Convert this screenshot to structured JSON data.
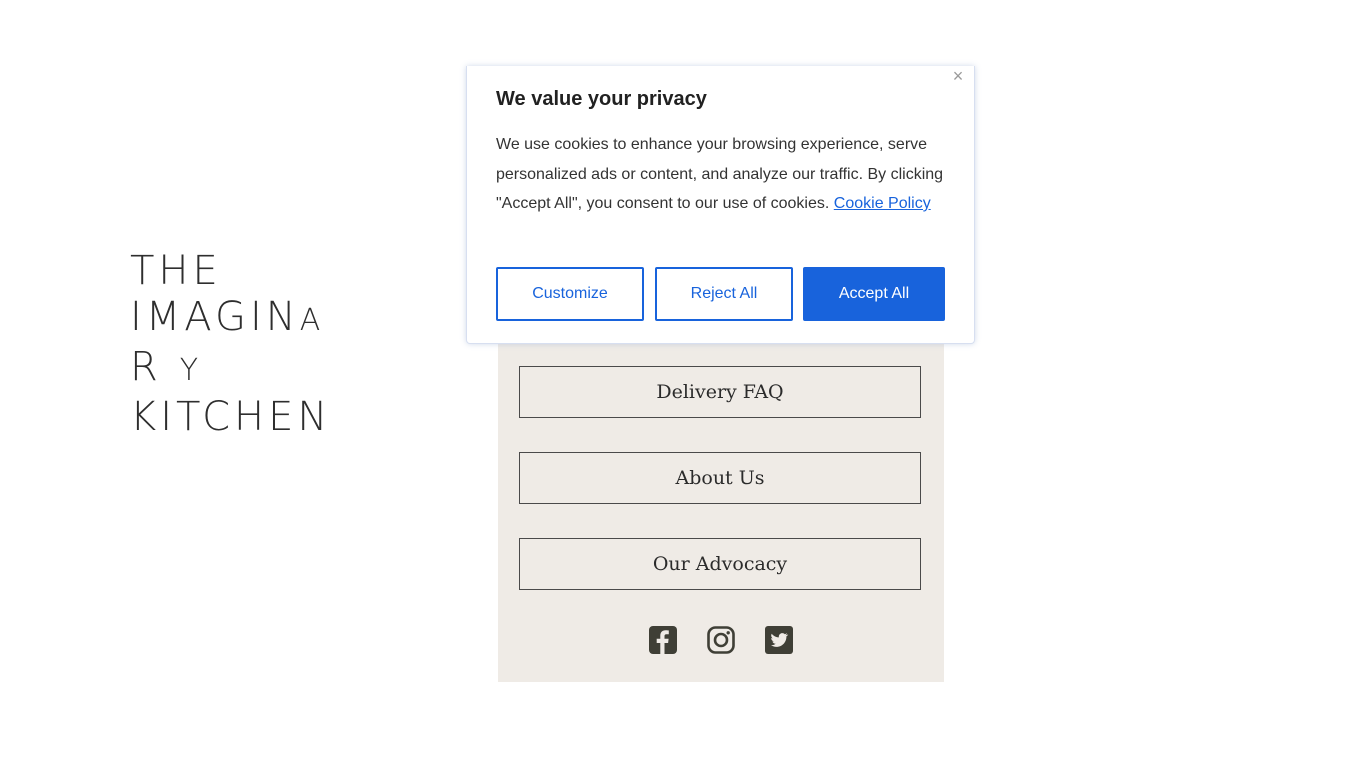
{
  "logo": {
    "line1": "THE",
    "line2a": "IMAGIN",
    "line2b": "A",
    "line3a": "R",
    "line3b": "Y",
    "line4": "KITCHEN"
  },
  "panel": {
    "links": [
      {
        "label": "Delivery FAQ"
      },
      {
        "label": "About Us"
      },
      {
        "label": "Our Advocacy"
      }
    ],
    "social_icons": [
      "facebook-icon",
      "instagram-icon",
      "twitter-icon"
    ],
    "icon_color": "#3f3f36",
    "background": "#efebe6"
  },
  "cookie_banner": {
    "close_symbol": "×",
    "title": "We value your privacy",
    "body": "We use cookies to enhance your browsing experience, serve personalized ads or content, and analyze our traffic. By clicking \"Accept All\", you consent to our use of cookies.",
    "policy_link": "Cookie Policy",
    "buttons": {
      "customize": "Customize",
      "reject": "Reject All",
      "accept": "Accept All"
    },
    "accent_color": "#1863dc"
  }
}
